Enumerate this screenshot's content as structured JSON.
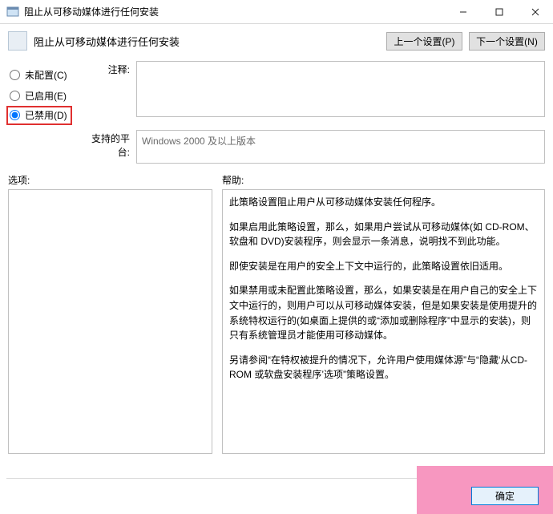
{
  "window": {
    "title": "阻止从可移动媒体进行任何安装"
  },
  "header": {
    "title": "阻止从可移动媒体进行任何安装",
    "prev_label": "上一个设置(P)",
    "next_label": "下一个设置(N)"
  },
  "radios": {
    "not_configured": "未配置(C)",
    "enabled": "已启用(E)",
    "disabled": "已禁用(D)",
    "selected": "disabled"
  },
  "labels": {
    "comment": "注释:",
    "platform": "支持的平台:",
    "options": "选项:",
    "help": "帮助:"
  },
  "platform_text": "Windows 2000 及以上版本",
  "help_paragraphs": [
    "此策略设置阻止用户从可移动媒体安装任何程序。",
    "如果启用此策略设置，那么，如果用户尝试从可移动媒体(如 CD-ROM、软盘和 DVD)安装程序，则会显示一条消息，说明找不到此功能。",
    "即使安装是在用户的安全上下文中运行的，此策略设置依旧适用。",
    "如果禁用或未配置此策略设置，那么，如果安装是在用户自己的安全上下文中运行的，则用户可以从可移动媒体安装，但是如果安装是使用提升的系统特权运行的(如桌面上提供的或“添加或删除程序”中显示的安装)，则只有系统管理员才能使用可移动媒体。",
    "另请参阅“在特权被提升的情况下，允许用户使用媒体源”与“隐藏‘从CD-ROM 或软盘安装程序’选项”策略设置。"
  ],
  "footer": {
    "ok_label": "确定"
  }
}
